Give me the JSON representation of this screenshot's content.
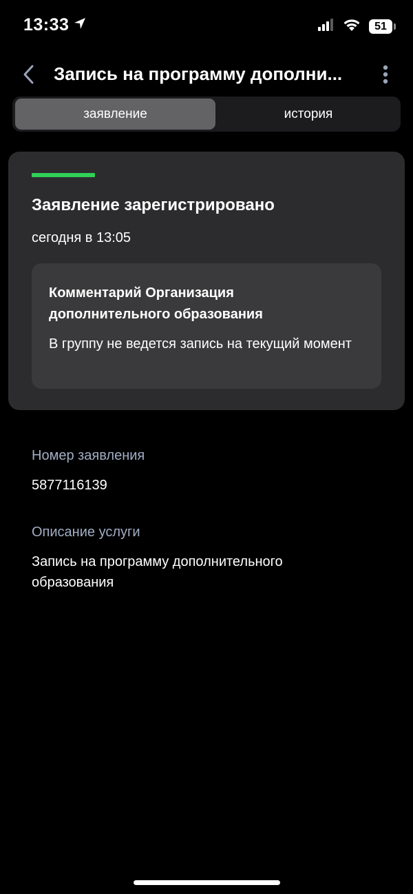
{
  "status_bar": {
    "time": "13:33",
    "battery": "51"
  },
  "header": {
    "title": "Запись на программу дополни..."
  },
  "tabs": [
    {
      "label": "заявление",
      "active": true
    },
    {
      "label": "история",
      "active": false
    }
  ],
  "status_card": {
    "title": "Заявление зарегистрировано",
    "date": "сегодня в 13:05",
    "progress_color": "#30d158",
    "comment": {
      "title": "Комментарий Организация дополнительного образования",
      "text": "В группу не ведется запись на текущий момент"
    }
  },
  "details": {
    "number_label": "Номер заявления",
    "number_value": "5877116139",
    "description_label": "Описание услуги",
    "description_value": "Запись на программу дополнительного образования"
  }
}
